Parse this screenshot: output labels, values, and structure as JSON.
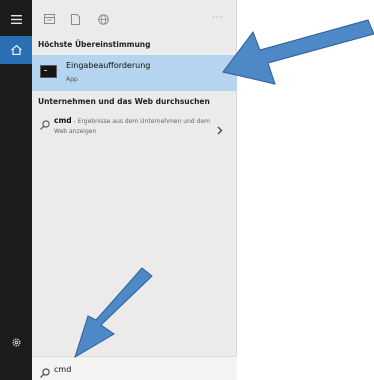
{
  "rail": {
    "icons": [
      "hamburger-menu-icon",
      "home-icon",
      "settings-gear-icon"
    ]
  },
  "topbar": {
    "icons": [
      "apps-view-icon",
      "documents-icon",
      "web-globe-icon"
    ],
    "more_label": "···"
  },
  "best_match": {
    "section_title": "Höchste Übereinstimmung",
    "title": "Eingabeaufforderung",
    "subtitle": "App",
    "icon": "command-prompt-icon"
  },
  "web_search": {
    "section_title": "Unternehmen und das Web durchsuchen",
    "query": "cmd",
    "description": " - Ergebnisse aus dem Unternehmen und dem Web anzeigen",
    "icon": "search-icon"
  },
  "search_box": {
    "value": "cmd"
  },
  "colors": {
    "rail": "#1c1c1c",
    "rail_active": "#2b6fb5",
    "panel": "#ebebeb",
    "selection": "#b5d4ef",
    "annotation_arrow": "#4f88c6"
  }
}
